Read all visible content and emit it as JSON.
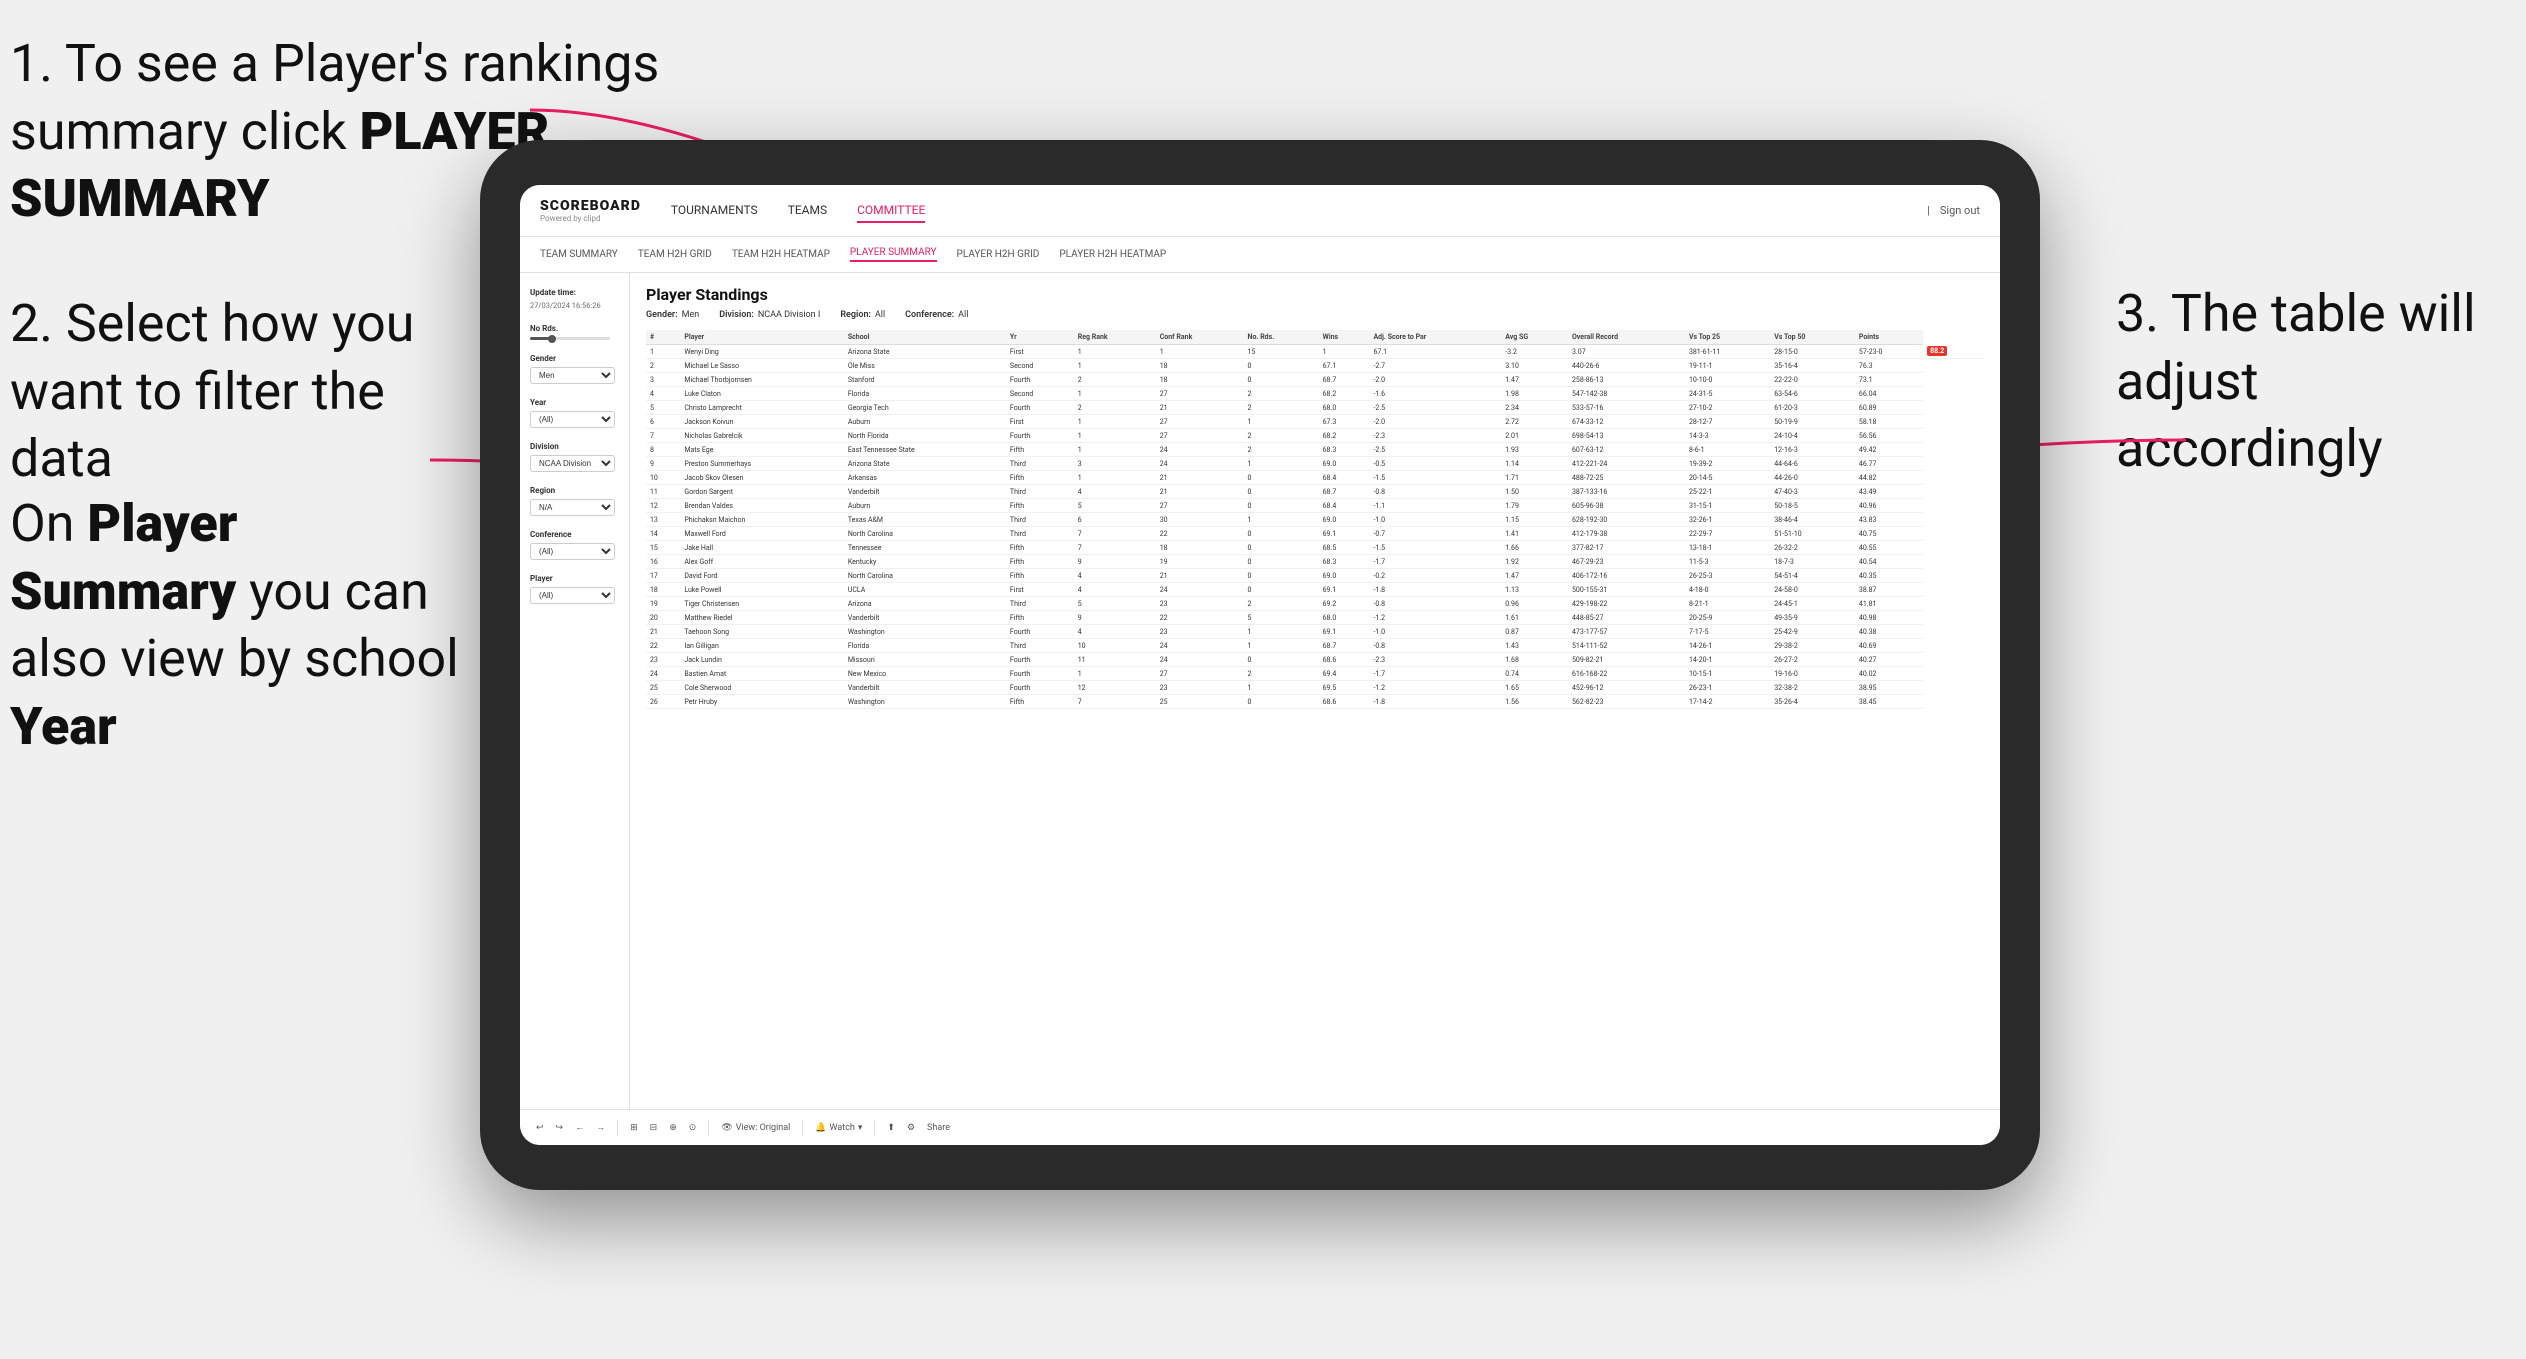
{
  "annotations": {
    "ann1": "1. To see a Player's rankings summary click ",
    "ann1_bold": "PLAYER SUMMARY",
    "ann2_title": "2. Select how you want to filter the data",
    "ann3_title": "On ",
    "ann3_bold1": "Player Summary",
    "ann3_mid": " you can also view by school ",
    "ann3_bold2": "Year",
    "ann_right": "3. The table will adjust accordingly"
  },
  "navbar": {
    "logo": "SCOREBOARD",
    "logo_sub": "Powered by clipd",
    "links": [
      "TOURNAMENTS",
      "TEAMS",
      "COMMITTEE"
    ],
    "active_link": "COMMITTEE",
    "nav_right": [
      "Sign out"
    ]
  },
  "subnav": {
    "links": [
      "TEAM SUMMARY",
      "TEAM H2H GRID",
      "TEAM H2H HEATMAP",
      "PLAYER SUMMARY",
      "PLAYER H2H GRID",
      "PLAYER H2H HEATMAP"
    ],
    "active": "PLAYER SUMMARY"
  },
  "sidebar": {
    "update_label": "Update time:",
    "update_date": "27/03/2024 16:56:26",
    "no_rds_label": "No Rds.",
    "gender_label": "Gender",
    "gender_value": "Men",
    "year_label": "Year",
    "year_value": "(All)",
    "division_label": "Division",
    "division_value": "NCAA Division I",
    "region_label": "Region",
    "region_value": "N/A",
    "conference_label": "Conference",
    "conference_value": "(All)",
    "player_label": "Player",
    "player_value": "(All)"
  },
  "table": {
    "title": "Player Standings",
    "filters": {
      "gender": {
        "label": "Gender:",
        "value": "Men"
      },
      "division": {
        "label": "Division:",
        "value": "NCAA Division I"
      },
      "region": {
        "label": "Region:",
        "value": "All"
      },
      "conference": {
        "label": "Conference:",
        "value": "All"
      }
    },
    "columns": [
      "#",
      "Player",
      "School",
      "Yr",
      "Reg Rank",
      "Conf Rank",
      "No. Rds.",
      "Wins",
      "Adj. Score to Par",
      "Avg SG",
      "Overall Record",
      "Vs Top 25",
      "Vs Top 50",
      "Points"
    ],
    "rows": [
      [
        "1",
        "Wenyi Ding",
        "Arizona State",
        "First",
        "1",
        "1",
        "15",
        "1",
        "67.1",
        "-3.2",
        "3.07",
        "381-61-11",
        "28-15-0",
        "57-23-0",
        "88.2"
      ],
      [
        "2",
        "Michael Le Sasso",
        "Ole Miss",
        "Second",
        "1",
        "18",
        "0",
        "67.1",
        "-2.7",
        "3.10",
        "440-26-6",
        "19-11-1",
        "35-16-4",
        "76.3"
      ],
      [
        "3",
        "Michael Thorbjornsen",
        "Stanford",
        "Fourth",
        "2",
        "18",
        "0",
        "68.7",
        "-2.0",
        "1.47",
        "258-86-13",
        "10-10-0",
        "22-22-0",
        "73.1"
      ],
      [
        "4",
        "Luke Claton",
        "Florida",
        "Second",
        "1",
        "27",
        "2",
        "68.2",
        "-1.6",
        "1.98",
        "547-142-38",
        "24-31-5",
        "63-54-6",
        "66.04"
      ],
      [
        "5",
        "Christo Lamprecht",
        "Georgia Tech",
        "Fourth",
        "2",
        "21",
        "2",
        "68.0",
        "-2.5",
        "2.34",
        "533-57-16",
        "27-10-2",
        "61-20-3",
        "60.89"
      ],
      [
        "6",
        "Jackson Koivun",
        "Auburn",
        "First",
        "1",
        "27",
        "1",
        "67.3",
        "-2.0",
        "2.72",
        "674-33-12",
        "28-12-7",
        "50-19-9",
        "58.18"
      ],
      [
        "7",
        "Nicholas Gabrelcik",
        "North Florida",
        "Fourth",
        "1",
        "27",
        "2",
        "68.2",
        "-2.3",
        "2.01",
        "698-54-13",
        "14-3-3",
        "24-10-4",
        "56.56"
      ],
      [
        "8",
        "Mats Ege",
        "East Tennessee State",
        "Fifth",
        "1",
        "24",
        "2",
        "68.3",
        "-2.5",
        "1.93",
        "607-63-12",
        "8-6-1",
        "12-16-3",
        "49.42"
      ],
      [
        "9",
        "Preston Summerhays",
        "Arizona State",
        "Third",
        "3",
        "24",
        "1",
        "69.0",
        "-0.5",
        "1.14",
        "412-221-24",
        "19-39-2",
        "44-64-6",
        "46.77"
      ],
      [
        "10",
        "Jacob Skov Olesen",
        "Arkansas",
        "Fifth",
        "1",
        "21",
        "0",
        "68.4",
        "-1.5",
        "1.71",
        "488-72-25",
        "20-14-5",
        "44-26-0",
        "44.82"
      ],
      [
        "11",
        "Gordon Sargent",
        "Vanderbilt",
        "Third",
        "4",
        "21",
        "0",
        "68.7",
        "-0.8",
        "1.50",
        "387-133-16",
        "25-22-1",
        "47-40-3",
        "43.49"
      ],
      [
        "12",
        "Brendan Valdes",
        "Auburn",
        "Fifth",
        "5",
        "27",
        "0",
        "68.4",
        "-1.1",
        "1.79",
        "605-96-38",
        "31-15-1",
        "50-18-5",
        "40.96"
      ],
      [
        "13",
        "Phichaksn Maichon",
        "Texas A&M",
        "Third",
        "6",
        "30",
        "1",
        "69.0",
        "-1.0",
        "1.15",
        "628-192-30",
        "32-26-1",
        "38-46-4",
        "43.83"
      ],
      [
        "14",
        "Maxwell Ford",
        "North Carolina",
        "Third",
        "7",
        "22",
        "0",
        "69.1",
        "-0.7",
        "1.41",
        "412-179-38",
        "22-29-7",
        "51-51-10",
        "40.75"
      ],
      [
        "15",
        "Jake Hall",
        "Tennessee",
        "Fifth",
        "7",
        "18",
        "0",
        "68.5",
        "-1.5",
        "1.66",
        "377-82-17",
        "13-18-1",
        "26-32-2",
        "40.55"
      ],
      [
        "16",
        "Alex Goff",
        "Kentucky",
        "Fifth",
        "9",
        "19",
        "0",
        "68.3",
        "-1.7",
        "1.92",
        "467-29-23",
        "11-5-3",
        "18-7-3",
        "40.54"
      ],
      [
        "17",
        "David Ford",
        "North Carolina",
        "Fifth",
        "4",
        "21",
        "0",
        "69.0",
        "-0.2",
        "1.47",
        "406-172-16",
        "26-25-3",
        "54-51-4",
        "40.35"
      ],
      [
        "18",
        "Luke Powell",
        "UCLA",
        "First",
        "4",
        "24",
        "0",
        "69.1",
        "-1.8",
        "1.13",
        "500-155-31",
        "4-18-0",
        "24-58-0",
        "38.87"
      ],
      [
        "19",
        "Tiger Christensen",
        "Arizona",
        "Third",
        "5",
        "23",
        "2",
        "69.2",
        "-0.8",
        "0.96",
        "429-198-22",
        "8-21-1",
        "24-45-1",
        "41.81"
      ],
      [
        "20",
        "Matthew Riedel",
        "Vanderbilt",
        "Fifth",
        "9",
        "22",
        "5",
        "68.0",
        "-1.2",
        "1.61",
        "448-85-27",
        "20-25-9",
        "49-35-9",
        "40.98"
      ],
      [
        "21",
        "Taehoon Song",
        "Washington",
        "Fourth",
        "4",
        "23",
        "1",
        "69.1",
        "-1.0",
        "0.87",
        "473-177-57",
        "7-17-5",
        "25-42-9",
        "40.38"
      ],
      [
        "22",
        "Ian Gilligan",
        "Florida",
        "Third",
        "10",
        "24",
        "1",
        "68.7",
        "-0.8",
        "1.43",
        "514-111-52",
        "14-26-1",
        "29-38-2",
        "40.69"
      ],
      [
        "23",
        "Jack Lundin",
        "Missouri",
        "Fourth",
        "11",
        "24",
        "0",
        "68.6",
        "-2.3",
        "1.68",
        "509-82-21",
        "14-20-1",
        "26-27-2",
        "40.27"
      ],
      [
        "24",
        "Bastien Amat",
        "New Mexico",
        "Fourth",
        "1",
        "27",
        "2",
        "69.4",
        "-1.7",
        "0.74",
        "616-168-22",
        "10-15-1",
        "19-16-0",
        "40.02"
      ],
      [
        "25",
        "Cole Sherwood",
        "Vanderbilt",
        "Fourth",
        "12",
        "23",
        "1",
        "69.5",
        "-1.2",
        "1.65",
        "452-96-12",
        "26-23-1",
        "32-38-2",
        "38.95"
      ],
      [
        "26",
        "Petr Hruby",
        "Washington",
        "Fifth",
        "7",
        "25",
        "0",
        "68.6",
        "-1.8",
        "1.56",
        "562-82-23",
        "17-14-2",
        "35-26-4",
        "38.45"
      ]
    ]
  },
  "toolbar": {
    "buttons": [
      "↩",
      "↪",
      "←",
      "→",
      "⊞",
      "⊟",
      "⊕",
      "⊙"
    ],
    "view_label": "View: Original",
    "watch_label": "Watch",
    "share_label": "Share"
  }
}
